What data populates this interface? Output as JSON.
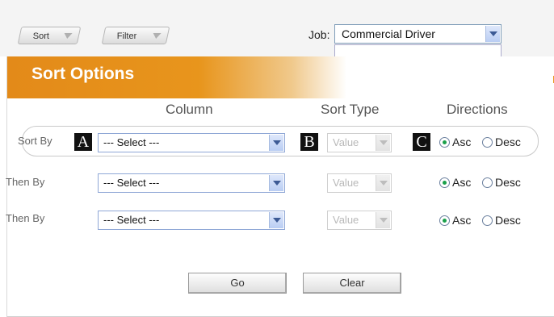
{
  "toolbar": {
    "sort_label": "Sort",
    "filter_label": "Filter",
    "job_label": "Job:",
    "job_value": "Commercial Driver"
  },
  "dialog": {
    "title": "Sort Options",
    "headers": {
      "column": "Column",
      "sort_type": "Sort Type",
      "directions": "Directions"
    },
    "rows": [
      {
        "label": "Sort By",
        "column_value": "--- Select ---",
        "type_value": "Value",
        "asc_label": "Asc",
        "desc_label": "Desc",
        "direction": "Asc"
      },
      {
        "label": "Then By",
        "column_value": "--- Select ---",
        "type_value": "Value",
        "asc_label": "Asc",
        "desc_label": "Desc",
        "direction": "Asc"
      },
      {
        "label": "Then By",
        "column_value": "--- Select ---",
        "type_value": "Value",
        "asc_label": "Asc",
        "desc_label": "Desc",
        "direction": "Asc"
      }
    ],
    "callouts": [
      "A",
      "B",
      "C"
    ],
    "go_label": "Go",
    "clear_label": "Clear"
  },
  "colors": {
    "header_orange": "#e38a19",
    "radio_selected": "#1aa04a"
  }
}
